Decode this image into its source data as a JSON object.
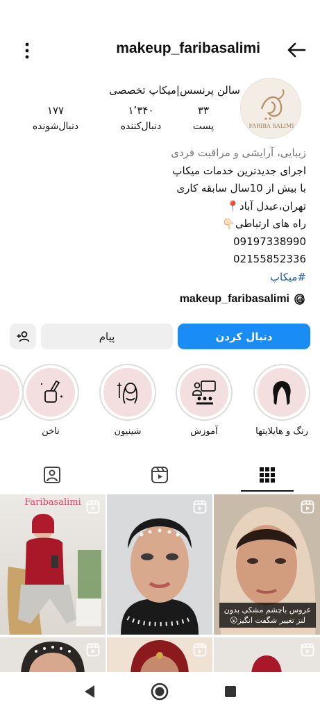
{
  "header": {
    "username": "makeup_faribasalimi"
  },
  "profile": {
    "display_name": "سالن پرنسس|میکاپ تخصصی",
    "avatar_text": "FARIBA SALIMI",
    "stats": {
      "posts_num": "۳۳",
      "posts_label": "پست",
      "followers_num": "۱٬۳۴۰",
      "followers_label": "دنبال‌کننده",
      "following_num": "۱۷۷",
      "following_label": "دنبال‌شونده"
    }
  },
  "bio": {
    "category": "زیبایی، آرایشی و مراقبت فردی",
    "line1": "اجرای جدیدترین خدمات میکاپ",
    "line2": "با بیش از 10سال سابقه کاری",
    "line3": "تهران،عبدل آباد📍",
    "line4": "راه های ارتباطی👇🏻",
    "phone1": "09197338990",
    "phone2": "02155852336",
    "hashtag": "#میکاپ",
    "threads_handle": "makeup_faribasalimi"
  },
  "buttons": {
    "follow": "دنبال کردن",
    "message": "پیام"
  },
  "highlights": [
    {
      "label": "رنگ و هایلایتها",
      "icon": "hair-icon"
    },
    {
      "label": "آموزش",
      "icon": "teaching-icon"
    },
    {
      "label": "شینیون",
      "icon": "bride-icon"
    },
    {
      "label": "ناخن",
      "icon": "nail-polish-icon"
    }
  ],
  "tabs": [
    "grid-icon",
    "reels-icon",
    "tagged-icon"
  ],
  "grid": {
    "watermark": "Faribasalimi",
    "caption": "عروس باچشم مشکی بدون لنز تغییر شگفت انگیز😮"
  },
  "colors": {
    "accent": "#1a8cf5",
    "highlight_bg": "#f3dfe0",
    "hashtag": "#1e5fa8"
  }
}
